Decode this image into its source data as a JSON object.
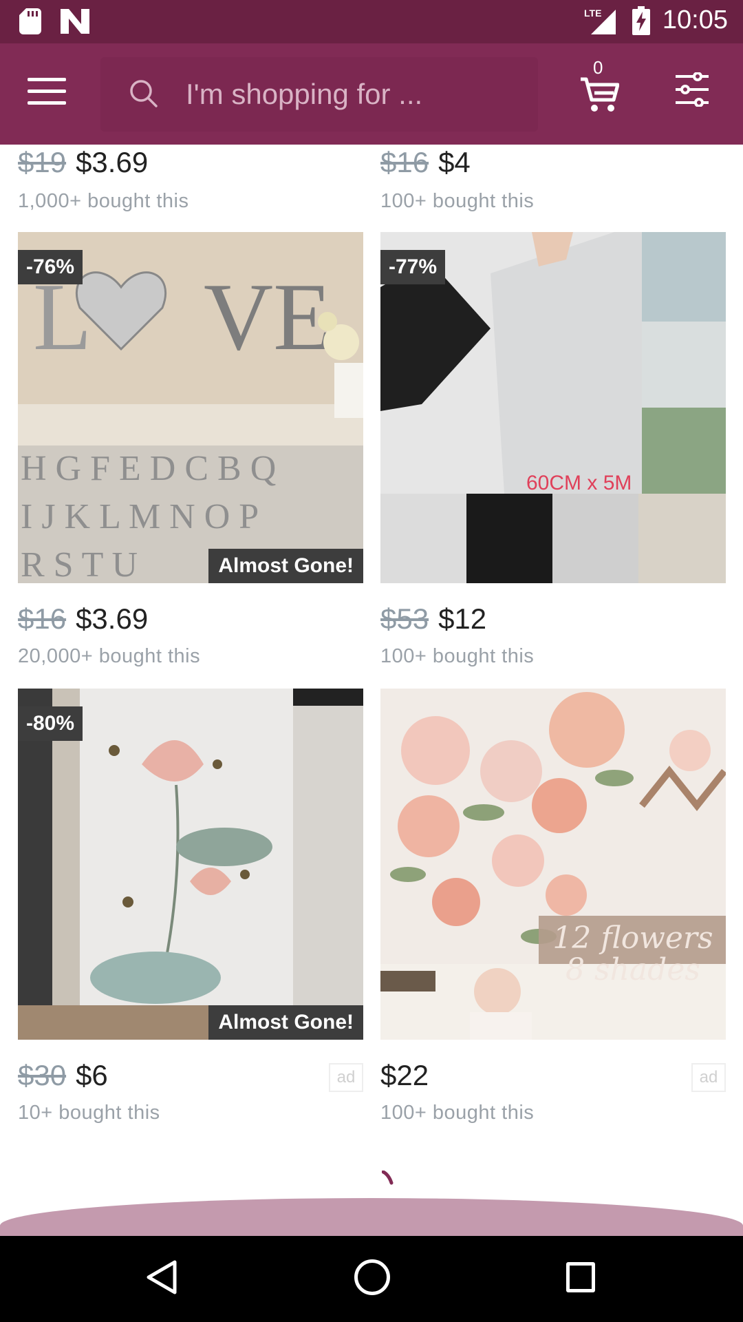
{
  "status_bar": {
    "time": "10:05",
    "network": "LTE"
  },
  "search": {
    "placeholder": "I'm shopping for ..."
  },
  "cart": {
    "count": "0"
  },
  "products": [
    {
      "old_price": "$19",
      "price": "$3.69",
      "bought": "1,000+ bought this"
    },
    {
      "old_price": "$16",
      "price": "$4",
      "bought": "100+ bought this"
    },
    {
      "discount": "-76%",
      "tag": "Almost Gone!",
      "old_price": "$16",
      "price": "$3.69",
      "bought": "20,000+ bought this"
    },
    {
      "discount": "-77%",
      "image_text": "60CM x 5M",
      "old_price": "$53",
      "price": "$12",
      "bought": "100+ bought this"
    },
    {
      "discount": "-80%",
      "tag": "Almost Gone!",
      "old_price": "$30",
      "price": "$6",
      "bought": "10+ bought this",
      "ad": "ad"
    },
    {
      "image_text": "12 flowers 8 shades",
      "price": "$22",
      "bought": "100+ bought this",
      "ad": "ad"
    }
  ],
  "colors": {
    "status_bar": "#6a2143",
    "app_bar": "#812b55",
    "badge": "#3d3d3d",
    "old_price": "#8f9ba5"
  }
}
